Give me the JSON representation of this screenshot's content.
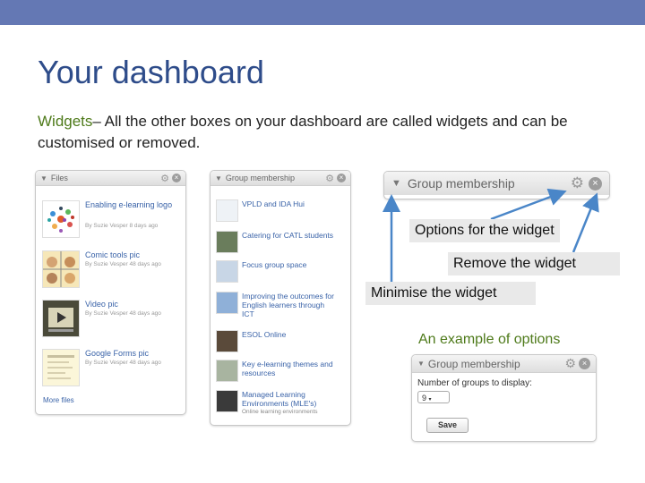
{
  "slide": {
    "title": "Your dashboard",
    "intro_keyword": "Widgets",
    "intro_text": "– All the other boxes on your dashboard are called widgets and can be customised or removed."
  },
  "files_widget": {
    "title": "Files",
    "items": [
      {
        "name": "Enabling e-learning logo",
        "meta": "By Suzie Vesper 8 days ago"
      },
      {
        "name": "Comic tools pic",
        "meta": "By Suzie Vesper 48 days ago"
      },
      {
        "name": "Video pic",
        "meta": "By Suzie Vesper 48 days ago"
      },
      {
        "name": "Google Forms pic",
        "meta": "By Suzie Vesper 48 days ago"
      }
    ],
    "more_link": "More files"
  },
  "group_widget": {
    "title": "Group membership",
    "items": [
      {
        "name": "VPLD and IDA Hui",
        "sub": ""
      },
      {
        "name": "Catering for CATL students",
        "sub": ""
      },
      {
        "name": "Focus group space",
        "sub": ""
      },
      {
        "name": "Improving the outcomes for English learners through ICT",
        "sub": ""
      },
      {
        "name": "ESOL Online",
        "sub": ""
      },
      {
        "name": "Key e-learning themes and resources",
        "sub": ""
      },
      {
        "name": "Managed Learning Environments (MLE's)",
        "sub": "Online learning environments"
      }
    ]
  },
  "big_widget": {
    "title": "Group membership"
  },
  "callouts": {
    "options": "Options for the widget",
    "remove": "Remove the widget",
    "minimise": "Minimise the widget",
    "example": "An example of options"
  },
  "options_widget": {
    "title": "Group membership",
    "field_label": "Number of groups to display:",
    "field_value": "9",
    "save_label": "Save"
  },
  "icons": {
    "collapse": "triangle-down-icon",
    "settings": "gear-icon",
    "close": "close-icon"
  },
  "colors": {
    "topbar": "#6478b4",
    "title": "#2e4c8a",
    "keyword": "#4e7a1a",
    "link": "#3a63a8",
    "arrow": "#4a86c8"
  }
}
